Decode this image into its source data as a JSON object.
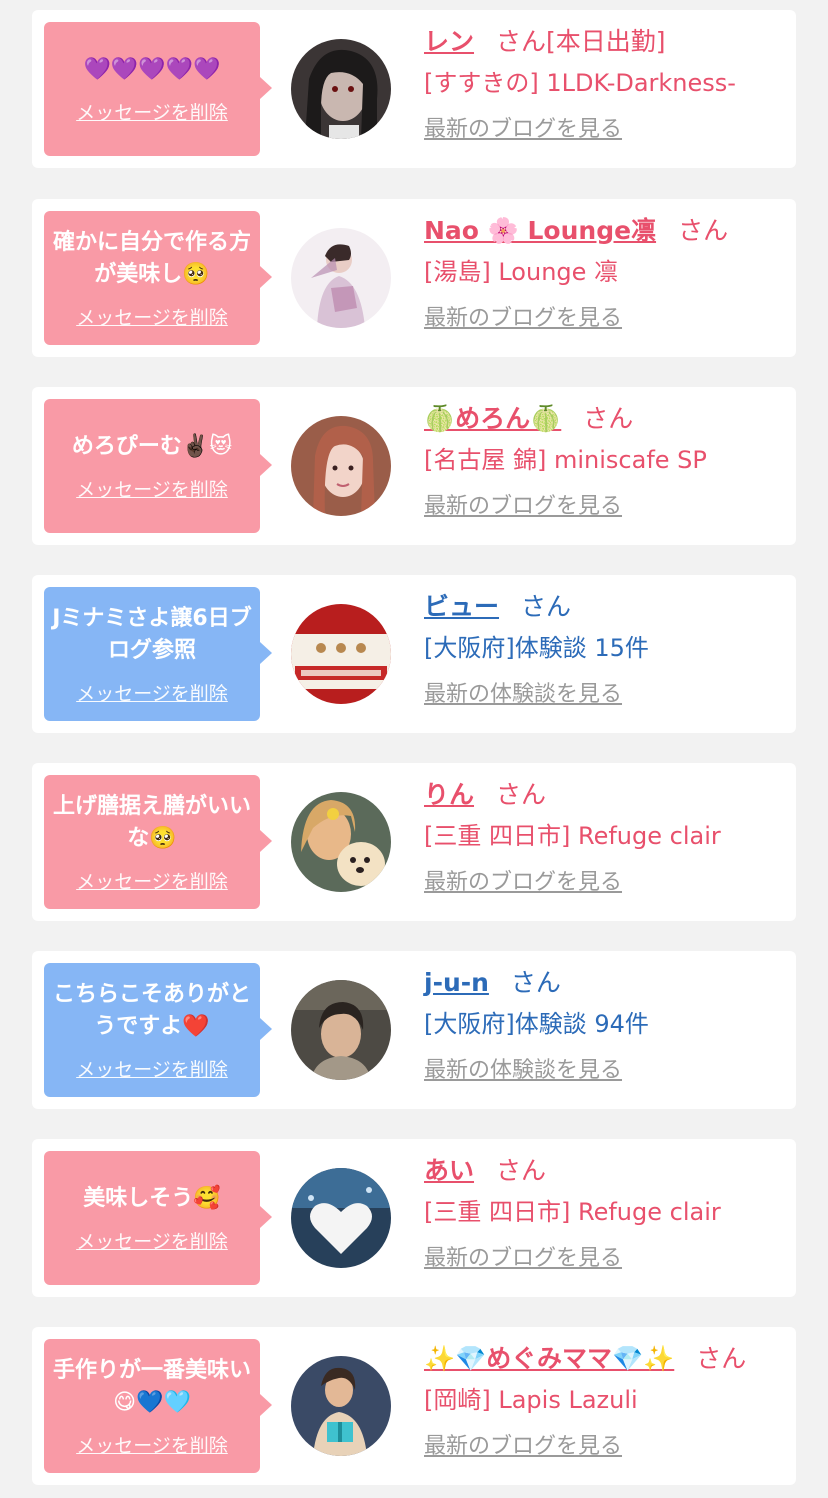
{
  "theme": {
    "pink": "#f99aa6",
    "blue": "#86b6f5",
    "pink_text": "#e8506c",
    "blue_text": "#2c6bb8",
    "link_gray": "#9a9a9a"
  },
  "san_label": "さん",
  "delete_label": "メッセージを削除",
  "items": [
    {
      "message": "💜💜💜💜💜",
      "name": "レン",
      "san": "さん[本日出勤]",
      "shop": "[すすきの] 1LDK-Darkness-",
      "link": "最新のブログを見る",
      "bubble_color": "pink",
      "avatar": "avatar-dark-portrait"
    },
    {
      "message": "確かに自分で作る方が美味し🥺",
      "name": "Nao 🌸 Lounge凛",
      "san": "さん",
      "shop": "[湯島] Lounge 凛",
      "link": "最新のブログを見る",
      "bubble_color": "pink",
      "avatar": "avatar-kimono-portrait"
    },
    {
      "message": "めろぴーむ✌🏿😻",
      "name": "🍈めろん🍈",
      "san": "さん",
      "shop": "[名古屋 錦] miniscafe SP",
      "link": "最新のブログを見る",
      "bubble_color": "pink",
      "avatar": "avatar-girl-portrait"
    },
    {
      "message": "Jミナミさよ譲6日ブログ参照",
      "name": "ビュー",
      "san": "さん",
      "shop": "[大阪府]体験談 15件",
      "link": "最新の体験談を見る",
      "bubble_color": "blue",
      "avatar": "avatar-snack-package"
    },
    {
      "message": "上げ膳据え膳がいいな🥺",
      "name": "りん",
      "san": "さん",
      "shop": "[三重 四日市] Refuge clair",
      "link": "最新のブログを見る",
      "bubble_color": "pink",
      "avatar": "avatar-girl-with-puppy"
    },
    {
      "message": "こちらこそありがとうですよ❤️",
      "name": "j-u-n",
      "san": "さん",
      "shop": "[大阪府]体験談 94件",
      "link": "最新の体験談を見る",
      "bubble_color": "blue",
      "avatar": "avatar-man-portrait"
    },
    {
      "message": "美味しそう🥰",
      "name": "あい",
      "san": "さん",
      "shop": "[三重 四日市] Refuge clair",
      "link": "最新のブログを見る",
      "bubble_color": "pink",
      "avatar": "avatar-white-heart"
    },
    {
      "message": "手作りが一番美味い😋💙🩵",
      "name": "✨💎めぐみママ💎✨",
      "san": "さん",
      "shop": "[岡崎] Lapis Lazuli",
      "link": "最新のブログを見る",
      "bubble_color": "pink",
      "avatar": "avatar-woman-with-gift"
    }
  ]
}
